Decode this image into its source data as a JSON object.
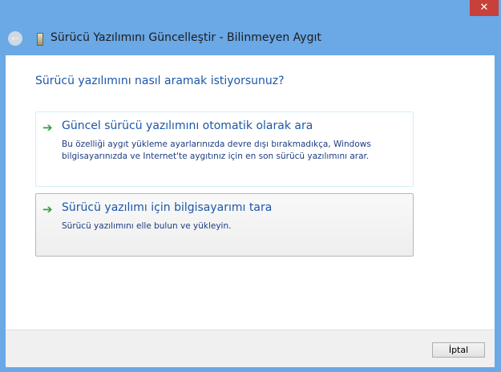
{
  "window": {
    "close_glyph": "✕",
    "title": "Sürücü Yazılımını Güncelleştir - Bilinmeyen Aygıt",
    "back_glyph": "←"
  },
  "main": {
    "question": "Sürücü yazılımını nasıl aramak istiyorsunuz?",
    "options": [
      {
        "title": "Güncel sürücü yazılımını otomatik olarak ara",
        "description": "Bu özelliği aygıt yükleme ayarlarınızda devre dışı bırakmadıkça, Windows bilgisayarınızda ve Internet'te aygıtınız için en son sürücü yazılımını arar.",
        "icon": "green-arrow-icon"
      },
      {
        "title": "Sürücü yazılımı için bilgisayarımı tara",
        "description": "Sürücü yazılımını elle bulun ve yükleyin.",
        "icon": "green-arrow-icon"
      }
    ]
  },
  "footer": {
    "cancel_label": "İptal"
  },
  "colors": {
    "accent": "#1c57a8",
    "arrow": "#2ea33e",
    "frame": "#6aa8e6",
    "close": "#c7403a"
  }
}
